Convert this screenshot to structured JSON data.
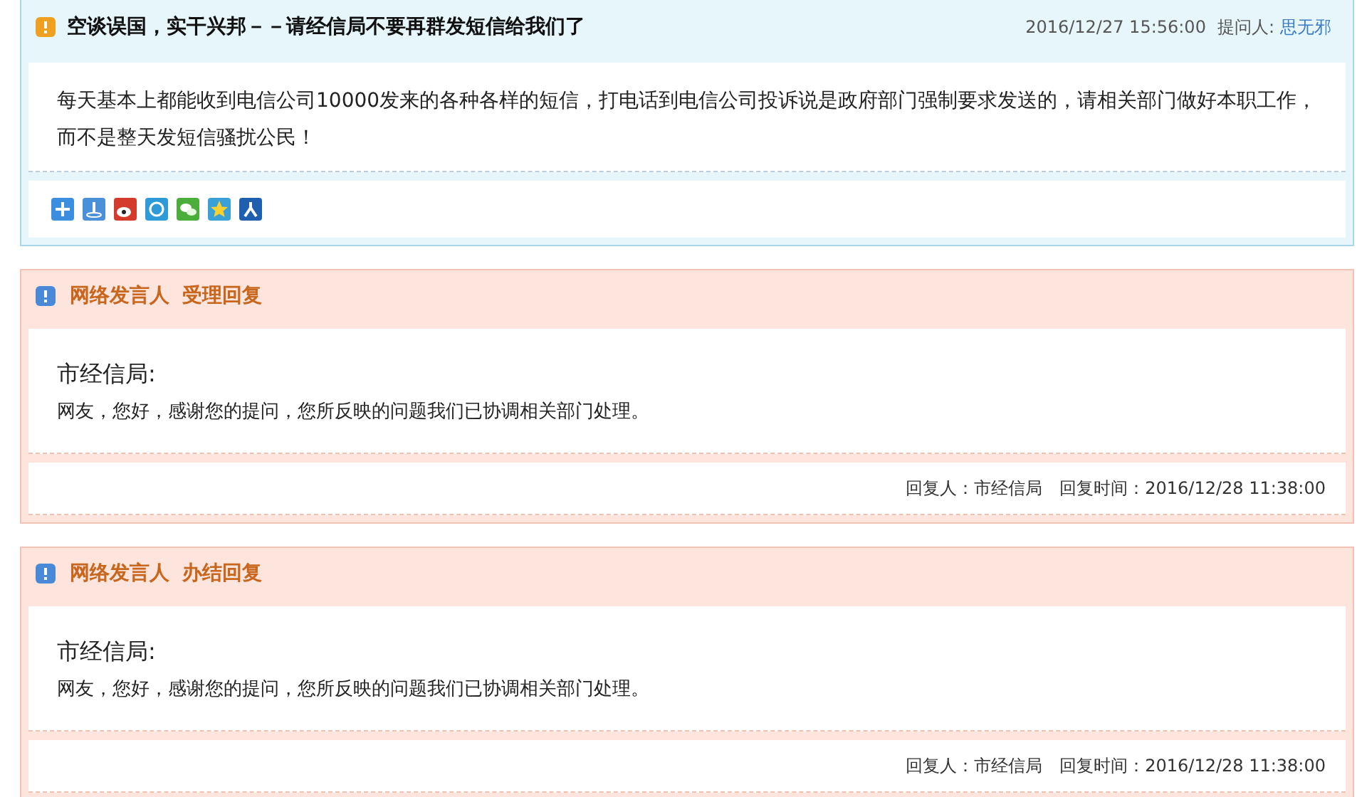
{
  "question": {
    "title": "空谈误国，实干兴邦－－请经信局不要再群发短信给我们了",
    "time": "2016/12/27 15:56:00",
    "asker_label": "提问人:",
    "asker": "思无邪",
    "body": "每天基本上都能收到电信公司10000发来的各种各样的短信，打电话到电信公司投诉说是政府部门强制要求发送的，请相关部门做好本职工作，而不是整天发短信骚扰公民！"
  },
  "replies": [
    {
      "title": "网络发言人 受理回复",
      "org": "市经信局:",
      "body": "网友，您好，感谢您的提问，您所反映的问题我们已协调相关部门处理。",
      "replier": "回复人：市经信局",
      "time": "回复时间：2016/12/28 11:38:00"
    },
    {
      "title": "网络发言人 办结回复",
      "org": "市经信局:",
      "body": "网友，您好，感谢您的提问，您所反映的问题我们已协调相关部门处理。",
      "replier": "回复人：市经信局",
      "time": "回复时间：2016/12/28 11:38:00"
    }
  ]
}
